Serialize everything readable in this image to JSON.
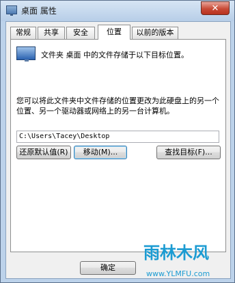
{
  "window": {
    "title": "桌面 属性",
    "close_label": "✕"
  },
  "tabs": [
    {
      "label": "常规"
    },
    {
      "label": "共享"
    },
    {
      "label": "安全"
    },
    {
      "label": "位置",
      "active": true
    },
    {
      "label": "以前的版本"
    }
  ],
  "location": {
    "info_text": "文件夹 桌面 中的文件存储于以下目标位置。",
    "description": "您可以将此文件夹中文件存储的位置更改为此硬盘上的另一个位置、另一个驱动器或网络上的另一台计算机。",
    "path_value": "C:\\Users\\Tacey\\Desktop",
    "restore_default_label": "还原默认值(R)",
    "move_label": "移动(M)...",
    "find_target_label": "查找目标(F)..."
  },
  "footer": {
    "ok_label": "确定"
  },
  "watermark": {
    "logo": "雨林木风",
    "url": "www.YLMFU.com"
  }
}
